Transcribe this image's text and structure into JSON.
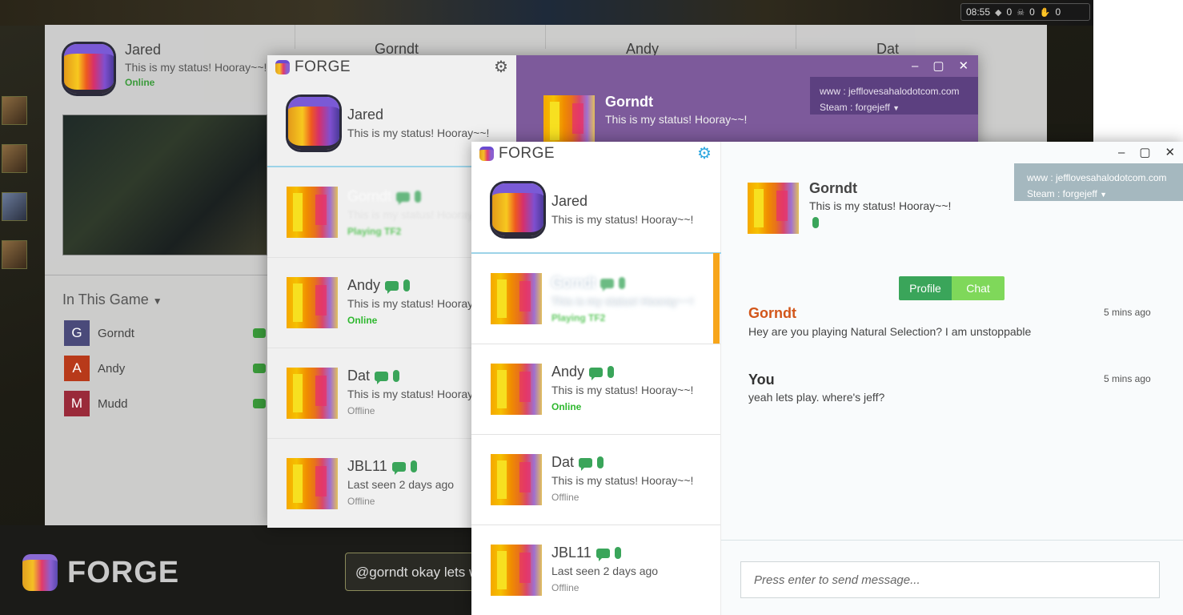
{
  "hud": {
    "time": "08:55",
    "a": "0",
    "b": "0",
    "c": "0"
  },
  "overlay": {
    "me": {
      "name": "Jared",
      "status": "This is my status! Hooray~~!",
      "presence": "Online"
    },
    "tabs": [
      {
        "name": "Gorndt"
      },
      {
        "name": "Andy"
      },
      {
        "name": "Dat"
      }
    ],
    "in_this_game": "In This Game",
    "players": [
      {
        "initial": "G",
        "name": "Gorndt",
        "color": "#4a4a7a"
      },
      {
        "initial": "A",
        "name": "Andy",
        "color": "#b83a1a"
      },
      {
        "initial": "M",
        "name": "Mudd",
        "color": "#9a2a3a"
      }
    ],
    "chat_input": "@gorndt okay lets wa",
    "brand": "FORGE"
  },
  "win1": {
    "brand": "FORGE",
    "me": {
      "name": "Jared",
      "status": "This is my status! Hooray~~!"
    },
    "contacts": [
      {
        "name": "Gorndt",
        "status": "This is my status! Hooray",
        "presence": "Playing TF2"
      },
      {
        "name": "Andy",
        "status": "This is my status! Hooray",
        "presence": "Online"
      },
      {
        "name": "Dat",
        "status": "This is my status! Hooray",
        "presence": "Offline"
      },
      {
        "name": "JBL11",
        "status": "Last seen 2 days ago",
        "presence": "Offline"
      }
    ],
    "profile": {
      "name": "Gorndt",
      "status": "This is my status! Hooray~~!"
    },
    "links": {
      "www": "www : jefflovesahalodotcom.com",
      "steam": "Steam : forgejeff"
    }
  },
  "win2": {
    "brand": "FORGE",
    "me": {
      "name": "Jared",
      "status": "This is my status! Hooray~~!"
    },
    "contacts": [
      {
        "name": "Gorndt",
        "status": "This is my status! Hooray~~!",
        "presence": "Playing TF2"
      },
      {
        "name": "Andy",
        "status": "This is my status! Hooray~~!",
        "presence": "Online"
      },
      {
        "name": "Dat",
        "status": "This is my status! Hooray~~!",
        "presence": "Offline"
      },
      {
        "name": "JBL11",
        "status": "Last seen 2 days ago",
        "presence": "Offline"
      }
    ],
    "profile": {
      "name": "Gorndt",
      "status": "This is my status! Hooray~~!"
    },
    "links": {
      "www": "www : jefflovesahalodotcom.com",
      "steam": "Steam : forgejeff"
    },
    "tabs": {
      "profile": "Profile",
      "chat": "Chat"
    },
    "messages": [
      {
        "author": "Gorndt",
        "time": "5 mins ago",
        "text": "Hey are you playing Natural Selection? I am unstoppable",
        "color": "#d2561a"
      },
      {
        "author": "You",
        "time": "5 mins ago",
        "text": "yeah lets play. where's jeff?",
        "color": "#333333"
      }
    ],
    "input_placeholder": "Press enter to send message..."
  },
  "colors": {
    "accent_green": "#3aa55a",
    "online": "#2fb82f",
    "purple": "#7d5a9b",
    "selected_bar": "#f7a51a",
    "gear_blue": "#2fa8e0"
  }
}
